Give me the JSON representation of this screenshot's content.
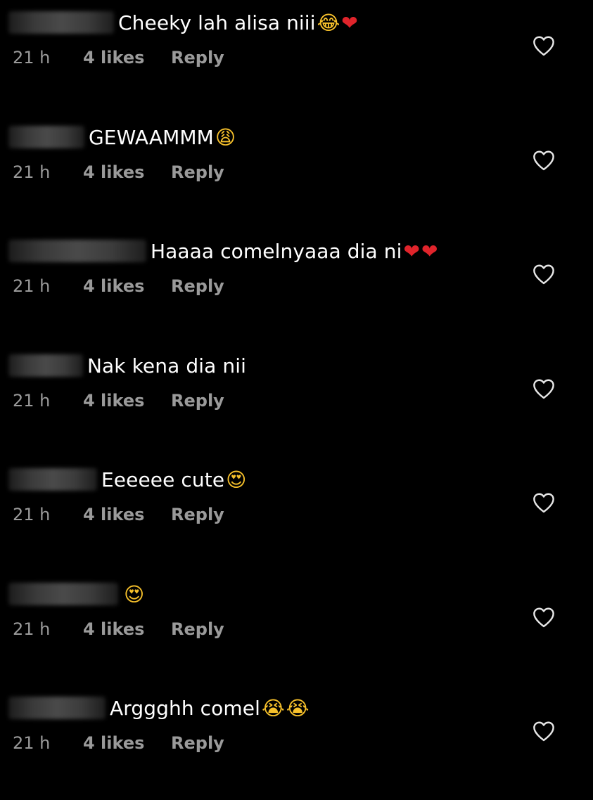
{
  "comments": [
    {
      "username_width": 150,
      "text": "Cheeky lah alisa niii",
      "emojis": [
        {
          "glyph": "😂",
          "kind": "face"
        },
        {
          "glyph": "❤",
          "kind": "heart"
        }
      ],
      "time": "21 h",
      "likes": "4 likes",
      "reply": "Reply"
    },
    {
      "username_width": 108,
      "text": "GEWAAMMM",
      "emojis": [
        {
          "glyph": "😩",
          "kind": "face"
        }
      ],
      "time": "21 h",
      "likes": "4 likes",
      "reply": "Reply"
    },
    {
      "username_width": 196,
      "text": "Haaaa comelnyaaa dia ni",
      "emojis": [
        {
          "glyph": "❤",
          "kind": "heart"
        },
        {
          "glyph": "❤",
          "kind": "heart"
        }
      ],
      "time": "21 h",
      "likes": "4 likes",
      "reply": "Reply"
    },
    {
      "username_width": 106,
      "text": "Nak kena dia nii",
      "emojis": [],
      "time": "21 h",
      "likes": "4 likes",
      "reply": "Reply"
    },
    {
      "username_width": 126,
      "text": "Eeeeee cute",
      "emojis": [
        {
          "glyph": "😍",
          "kind": "face"
        }
      ],
      "time": "21 h",
      "likes": "4 likes",
      "reply": "Reply"
    },
    {
      "username_width": 156,
      "text": "",
      "emojis": [
        {
          "glyph": "😍",
          "kind": "face"
        }
      ],
      "time": "21 h",
      "likes": "4 likes",
      "reply": "Reply"
    },
    {
      "username_width": 138,
      "text": "Arggghh comel",
      "emojis": [
        {
          "glyph": "😭",
          "kind": "face"
        },
        {
          "glyph": "😭",
          "kind": "face"
        }
      ],
      "time": "21 h",
      "likes": "4 likes",
      "reply": "Reply"
    }
  ]
}
